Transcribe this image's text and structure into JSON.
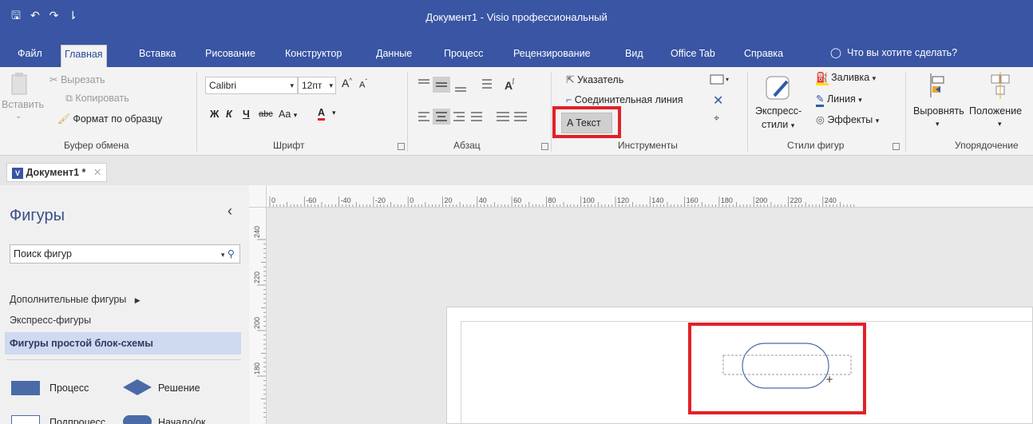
{
  "window": {
    "title": "Документ1  -  Visio профессиональный"
  },
  "qat": {
    "save": "🖫",
    "undo": "↶",
    "redo": "↷",
    "more": "⇂"
  },
  "menu": {
    "tabs": [
      "Файл",
      "Главная",
      "Вставка",
      "Рисование",
      "Конструктор",
      "Данные",
      "Процесс",
      "Рецензирование",
      "Вид",
      "Office Tab",
      "Справка"
    ],
    "tell_me": "Что вы хотите сделать?"
  },
  "ribbon": {
    "clipboard": {
      "paste": "Вставить",
      "cut": "Вырезать",
      "copy": "Копировать",
      "format_painter": "Формат по образцу",
      "label": "Буфер обмена"
    },
    "font": {
      "name": "Calibri",
      "size": "12пт",
      "bold": "Ж",
      "italic": "К",
      "underline": "Ч",
      "strike": "abc",
      "case": "Aa",
      "color": "A",
      "grow": "A",
      "shrink": "A",
      "label": "Шрифт"
    },
    "paragraph": {
      "label": "Абзац"
    },
    "tools": {
      "pointer": "Указатель",
      "connector": "Соединительная линия",
      "text": "Текст",
      "label": "Инструменты"
    },
    "shape_styles": {
      "quick_styles_1": "Экспресс-",
      "quick_styles_2": "стили",
      "fill": "Заливка",
      "line": "Линия",
      "effects": "Эффекты",
      "label": "Стили фигур"
    },
    "arrange": {
      "align": "Выровнять",
      "position": "Положение",
      "label": "Упорядочение"
    }
  },
  "document_tab": {
    "label": "Документ1 *"
  },
  "shapes_panel": {
    "title": "Фигуры",
    "search_placeholder": "Поиск фигур",
    "more_shapes": "Дополнительные фигуры",
    "quick_shapes": "Экспресс-фигуры",
    "basic_flowchart": "Фигуры простой блок-схемы",
    "stencil": [
      "Процесс",
      "Решение",
      "Подпроцесс",
      "Начало/ок..."
    ]
  },
  "ruler": {
    "h_labels": [
      "0",
      "-60",
      "-40",
      "-20",
      "0",
      "20",
      "40",
      "60",
      "80",
      "100",
      "120",
      "140",
      "160",
      "180",
      "200",
      "220",
      "240"
    ],
    "v_labels": [
      "240",
      "220",
      "200",
      "180"
    ]
  },
  "colors": {
    "title_bar": "#3955a3",
    "highlight": "#e12129",
    "shape_stroke": "#4a6aa8"
  }
}
